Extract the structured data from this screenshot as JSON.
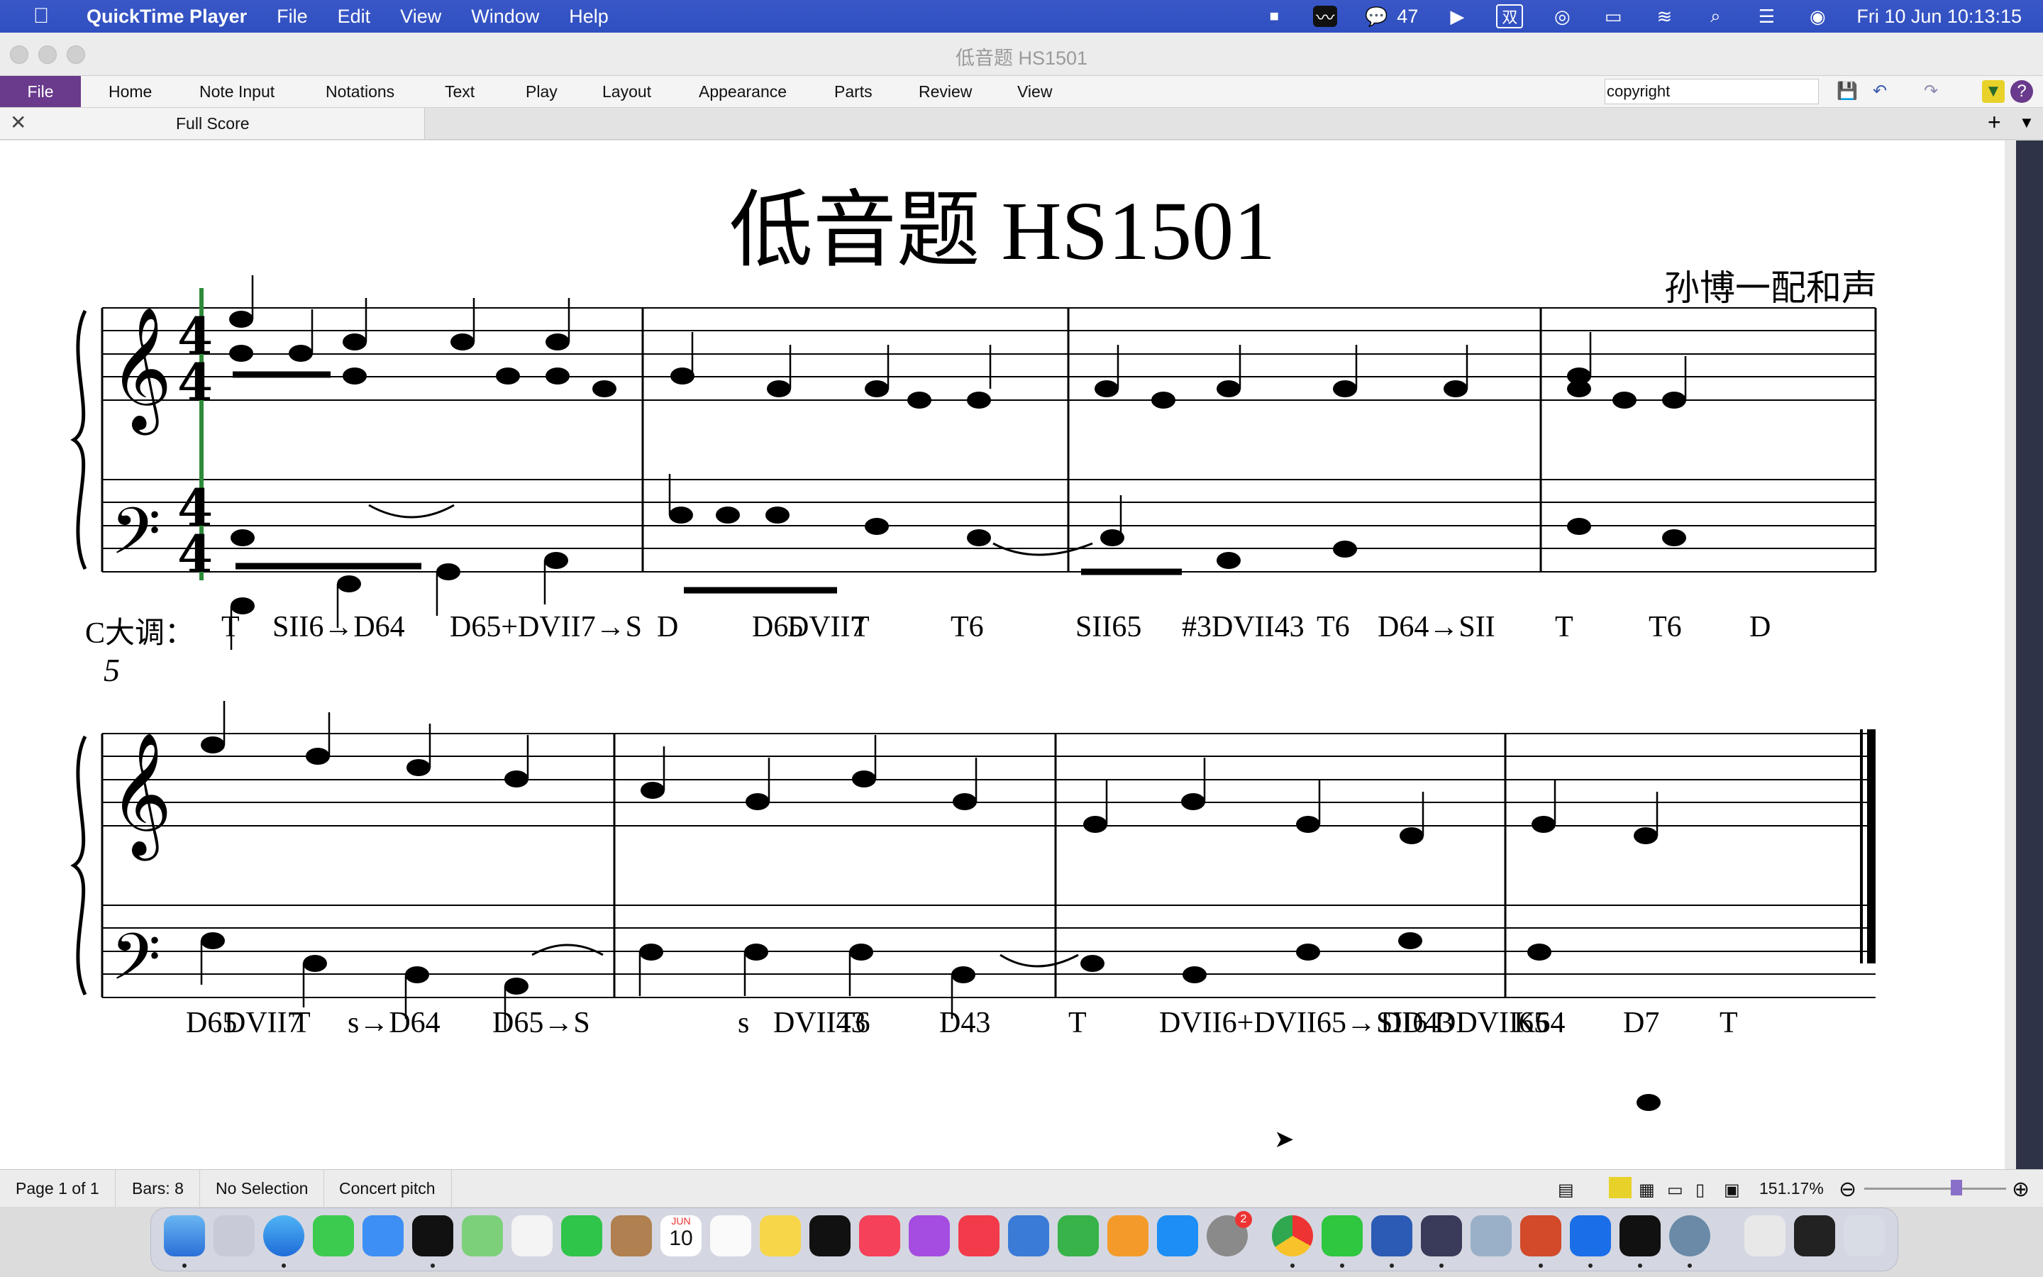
{
  "menubar": {
    "app_name": "QuickTime Player",
    "items": [
      "File",
      "Edit",
      "View",
      "Window",
      "Help"
    ],
    "wechat_count": "47",
    "input_method": "双",
    "datetime": "Fri 10 Jun  10:13:15"
  },
  "window": {
    "title": "低音题 HS1501"
  },
  "ribbon": {
    "file": "File",
    "tabs": [
      "Home",
      "Note Input",
      "Notations",
      "Text",
      "Play",
      "Layout",
      "Appearance",
      "Parts",
      "Review",
      "View"
    ],
    "search_value": "copyright"
  },
  "tabbar": {
    "tab_label": "Full Score"
  },
  "score": {
    "title": "低音题 HS1501",
    "composer": "孙博一配和声",
    "time_signature": "4/4",
    "bar_number_system2": "5",
    "key_label": "C大调：",
    "analysis_row1": [
      "T",
      "SII6→D64",
      "D65+DVII7→S",
      "D",
      "D65",
      "DVII7",
      "T",
      "T6",
      "SII65",
      "#3DVII43",
      "T6",
      "D64→SII",
      "T",
      "T6",
      "D"
    ],
    "analysis_row2": [
      "D65",
      "DVII7",
      "T",
      "s→D64",
      "D65→S",
      "s",
      "DVII43",
      "T6",
      "D43",
      "T",
      "DVII6+DVII65→SII6",
      "DD43",
      "DDVII65",
      "K64",
      "D7",
      "T"
    ]
  },
  "status": {
    "page": "Page 1 of 1",
    "bars": "Bars: 8",
    "selection": "No Selection",
    "pitch": "Concert pitch",
    "zoom": "151.17%"
  },
  "dock": {
    "calendar_month": "JUN",
    "calendar_day": "10",
    "badge": "2"
  },
  "colors": {
    "menubar": "#3152c4",
    "file_tab": "#6a3a8c",
    "playback_line": "#2e8b3a"
  }
}
